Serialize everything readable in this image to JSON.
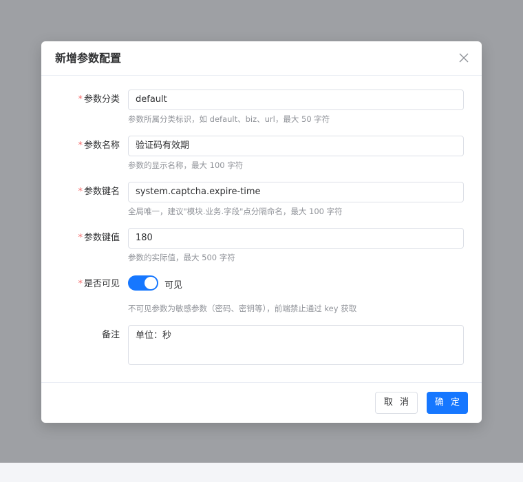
{
  "dialog": {
    "title": "新增参数配置",
    "close_icon": "close-icon"
  },
  "form": {
    "category": {
      "label": "参数分类",
      "required": true,
      "value": "default",
      "hint": "参数所属分类标识，如 default、biz、url，最大 50 字符"
    },
    "name": {
      "label": "参数名称",
      "required": true,
      "value": "验证码有效期",
      "hint": "参数的显示名称，最大 100 字符"
    },
    "key": {
      "label": "参数键名",
      "required": true,
      "value": "system.captcha.expire-time",
      "hint": "全局唯一，建议\"模块.业务.字段\"点分隔命名，最大 100 字符"
    },
    "value": {
      "label": "参数键值",
      "required": true,
      "value": "180",
      "hint": "参数的实际值，最大 500 字符"
    },
    "visible": {
      "label": "是否可见",
      "required": true,
      "checked": true,
      "text": "可见",
      "hint": "不可见参数为敏感参数（密码、密钥等），前端禁止通过 key 获取"
    },
    "remark": {
      "label": "备注",
      "required": false,
      "value": "单位：秒"
    }
  },
  "footer": {
    "cancel_label": "取 消",
    "confirm_label": "确 定"
  },
  "colors": {
    "primary": "#1677ff",
    "required_star": "#f56c6c",
    "backdrop": "#9ea0a4"
  }
}
